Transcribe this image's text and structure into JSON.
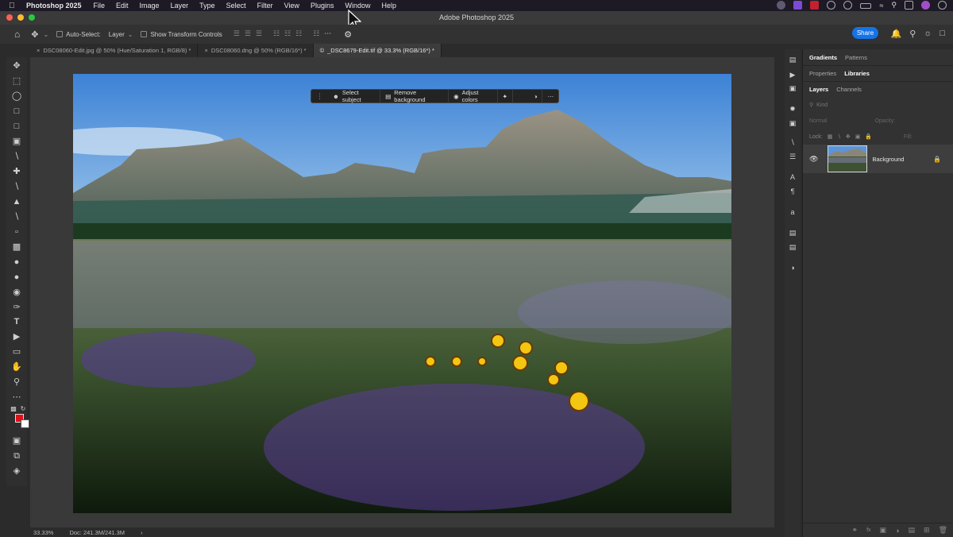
{
  "menubar": {
    "app_name": "Photoshop 2025",
    "items": [
      "File",
      "Edit",
      "Image",
      "Layer",
      "Type",
      "Select",
      "Filter",
      "View",
      "Plugins",
      "Window",
      "Help"
    ]
  },
  "titlebar": {
    "title": "Adobe Photoshop 2025"
  },
  "options": {
    "auto_select_label": "Auto-Select:",
    "auto_select_value": "Layer",
    "transform_label": "Show Transform Controls",
    "share_label": "Share"
  },
  "tabs": [
    {
      "label": "DSC08060-Edit.jpg @ 50% (Hue/Saturation 1, RGB/8) *",
      "active": false
    },
    {
      "label": "DSC08060.dng @ 50% (RGB/16*) *",
      "active": false
    },
    {
      "label": "_DSC8679-Edit.tif @ 33.3% (RGB/16*) *",
      "active": true
    }
  ],
  "contextual_bar": {
    "select_subject": "Select subject",
    "remove_background": "Remove background",
    "adjust_colors": "Adjust colors"
  },
  "statusbar": {
    "zoom": "33.33%",
    "doc_size": "Doc: 241.3M/241.3M"
  },
  "panels": {
    "top_tabs": [
      "Gradients",
      "Patterns"
    ],
    "mid_tabs": [
      "Properties",
      "Libraries"
    ],
    "layer_tabs": [
      "Layers",
      "Channels"
    ],
    "kind_placeholder": "Kind",
    "blend_mode": "Normal",
    "opacity_label": "Opacity:",
    "lock_label": "Lock:",
    "fill_label": "Fill:",
    "layer_name": "Background"
  },
  "colors": {
    "accent": "#1473e6",
    "foreground_color": "#e11018",
    "background_color": "#ffffff"
  }
}
